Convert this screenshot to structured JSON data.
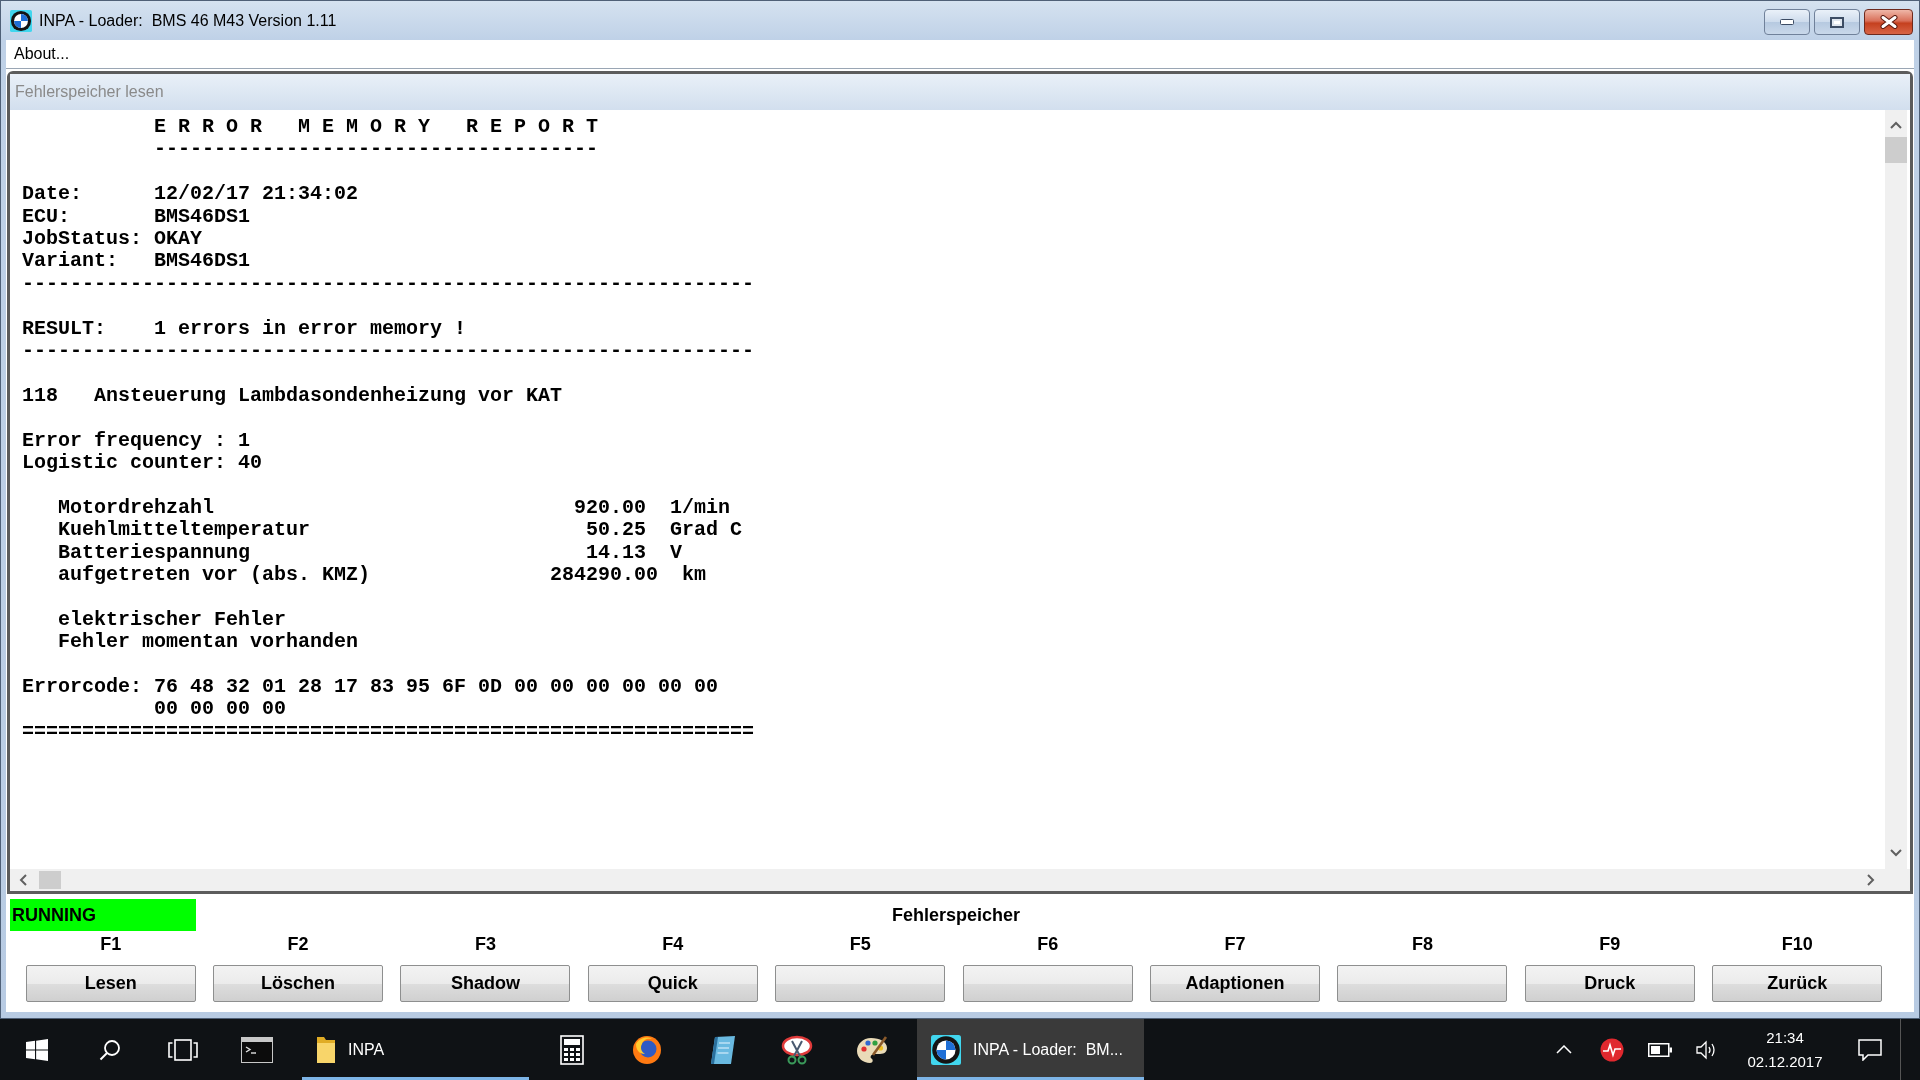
{
  "window": {
    "title": "INPA - Loader:  BMS 46 M43 Version 1.11"
  },
  "menu": [
    {
      "label": "About..."
    }
  ],
  "document": {
    "title": "Fehlerspeicher lesen",
    "blocks": [
      {
        "lines": [
          {
            "kind": "heading",
            "text": "E R R O R   M E M O R Y   R E P O R T"
          },
          {
            "kind": "heading-rule",
            "text": "-------------------------------------"
          }
        ]
      },
      {
        "lines": [
          {
            "kind": "line",
            "text": "Date:      12/02/17 21:34:02"
          },
          {
            "kind": "line",
            "text": "ECU:       BMS46DS1"
          },
          {
            "kind": "line",
            "text": "JobStatus: OKAY"
          },
          {
            "kind": "line",
            "text": "Variant:   BMS46DS1"
          },
          {
            "kind": "rule",
            "text": "-------------------------------------------------------------"
          }
        ]
      },
      {
        "lines": [
          {
            "kind": "line",
            "text": "RESULT:    1 errors in error memory !"
          },
          {
            "kind": "rule",
            "text": "-------------------------------------------------------------"
          }
        ]
      },
      {
        "lines": [
          {
            "kind": "line",
            "text": "118   Ansteuerung Lambdasondenheizung vor KAT"
          }
        ]
      },
      {
        "lines": [
          {
            "kind": "line",
            "text": "Error frequency : 1"
          },
          {
            "kind": "line",
            "text": "Logistic counter: 40"
          }
        ]
      },
      {
        "lines": [
          {
            "kind": "detail",
            "text": "Motordrehzahl                              920.00  1/min"
          },
          {
            "kind": "detail",
            "text": "Kuehlmitteltemperatur                       50.25  Grad C"
          },
          {
            "kind": "detail",
            "text": "Batteriespannung                            14.13  V"
          },
          {
            "kind": "detail",
            "text": "aufgetreten vor (abs. KMZ)               284290.00  km"
          }
        ]
      },
      {
        "lines": [
          {
            "kind": "detail",
            "text": "elektrischer Fehler"
          },
          {
            "kind": "detail",
            "text": "Fehler momentan vorhanden"
          }
        ]
      },
      {
        "lines": [
          {
            "kind": "line",
            "text": "Errorcode: 76 48 32 01 28 17 83 95 6F 0D 00 00 00 00 00 00"
          },
          {
            "kind": "continuation",
            "text": "00 00 00 00"
          },
          {
            "kind": "rule",
            "text": "============================================================="
          }
        ]
      }
    ]
  },
  "status": {
    "text": "RUNNING",
    "running": true
  },
  "screen_title": "Fehlerspeicher",
  "function_keys": [
    {
      "key": "F1",
      "label": "Lesen"
    },
    {
      "key": "F2",
      "label": "Löschen"
    },
    {
      "key": "F3",
      "label": "Shadow"
    },
    {
      "key": "F4",
      "label": "Quick"
    },
    {
      "key": "F5"
    },
    {
      "key": "F6"
    },
    {
      "key": "F7",
      "label": "Adaptionen"
    },
    {
      "key": "F8"
    },
    {
      "key": "F9",
      "label": "Druck"
    },
    {
      "key": "F10",
      "label": "Zurück"
    }
  ],
  "taskbar": {
    "apps": [
      {
        "kind": "terminal",
        "running": false,
        "selected": false
      },
      {
        "kind": "folder",
        "label": "INPA",
        "running": true,
        "selected": false
      },
      {
        "kind": "calculator",
        "running": false,
        "selected": false
      },
      {
        "kind": "globe",
        "running": false,
        "selected": false
      },
      {
        "kind": "notebook",
        "running": false,
        "selected": false
      },
      {
        "kind": "scissors",
        "running": false,
        "selected": false
      },
      {
        "kind": "palette",
        "running": false,
        "selected": false
      },
      {
        "kind": "roundel",
        "label": "INPA - Loader:  BM...",
        "running": true,
        "selected": true
      }
    ],
    "clock": {
      "time": "21:34",
      "date": "02.12.2017"
    }
  }
}
